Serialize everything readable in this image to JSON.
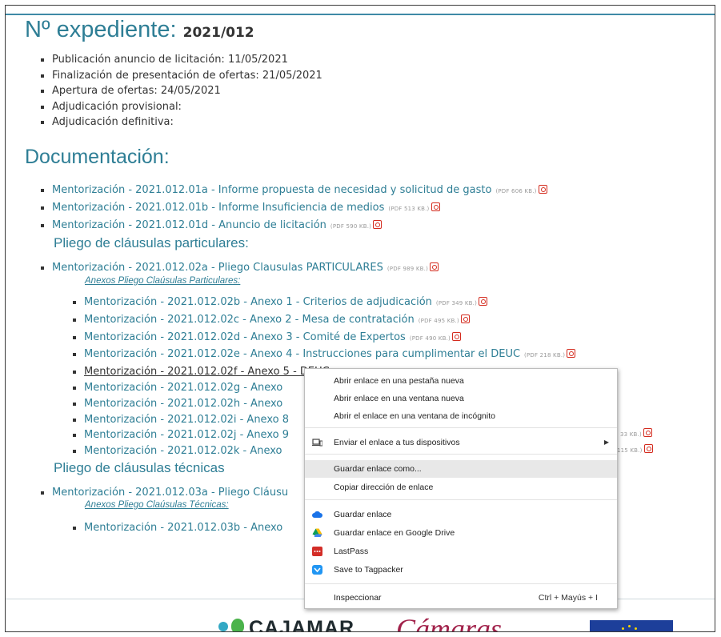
{
  "header": {
    "label": "Nº expediente:",
    "number": "2021/012"
  },
  "dates": [
    "Publicación anuncio de licitación: 11/05/2021",
    "Finalización de presentación de ofertas: 21/05/2021",
    "Apertura de ofertas: 24/05/2021",
    "Adjudicación provisional:",
    "Adjudicación definitiva:"
  ],
  "documentation": {
    "title": "Documentación:",
    "docs": [
      {
        "text": "Mentorización - 2021.012.01a - Informe propuesta de necesidad y solicitud de gasto",
        "size": "(PDF 606 KB.)"
      },
      {
        "text": "Mentorización - 2021.012.01b - Informe Insuficiencia de medios",
        "size": "(PDF 513 KB.)"
      },
      {
        "text": "Mentorización - 2021.012.01d - Anuncio de licitación",
        "size": "(PDF 590 KB.)"
      }
    ],
    "particulares": {
      "title": "Pliego de cláusulas particulares:",
      "main": {
        "text": "Mentorización - 2021.012.02a - Pliego Clausulas PARTICULARES",
        "size": "(PDF 989 KB.)"
      },
      "annex_label": "Anexos Pliego Claúsulas Particulares:",
      "annexes": [
        {
          "text": "Mentorización - 2021.012.02b - Anexo 1 - Criterios de adjudicación",
          "size": "(PDF 349 KB.)"
        },
        {
          "text": "Mentorización - 2021.012.02c - Anexo 2 - Mesa de contratación",
          "size": "(PDF 495 KB.)"
        },
        {
          "text": "Mentorización - 2021.012.02d - Anexo 3 - Comité de Expertos",
          "size": "(PDF 490 KB.)"
        },
        {
          "text": "Mentorización - 2021.012.02e - Anexo 4 - Instrucciones para cumplimentar el DEUC",
          "size": "(PDF 218 KB.)"
        },
        {
          "text": "Mentorización - 2021.012.02f - Anexo 5 - DEUC",
          "size": ""
        },
        {
          "text": "Mentorización - 2021.012.02g - Anexo",
          "size": ""
        },
        {
          "text": "Mentorización - 2021.012.02h - Anexo",
          "size": ""
        },
        {
          "text": "Mentorización - 2021.012.02i - Anexo 8",
          "size": ""
        },
        {
          "text": "Mentorización - 2021.012.02j - Anexo 9",
          "size": "33 KB.)"
        },
        {
          "text": "Mentorización - 2021.012.02k - Anexo",
          "size": "115 KB.)"
        }
      ]
    },
    "tecnicas": {
      "title": "Pliego de cláusulas técnicas",
      "main": {
        "text": "Mentorización - 2021.012.03a - Pliego Cláusu"
      },
      "annex_label": "Anexos Pliego Claúsulas Técnicas:",
      "annexes": [
        {
          "text": "Mentorización - 2021.012.03b - Anexo"
        }
      ]
    }
  },
  "context_menu": {
    "items": [
      {
        "label": "Abrir enlace en una pestaña nueva"
      },
      {
        "label": "Abrir enlace en una ventana nueva"
      },
      {
        "label": "Abrir el enlace en una ventana de incógnito"
      },
      {
        "label": "Enviar el enlace a tus dispositivos",
        "icon": "devices-icon"
      },
      {
        "label": "Guardar enlace como...",
        "highlighted": true
      },
      {
        "label": "Copiar dirección de enlace"
      },
      {
        "label": "Guardar enlace",
        "icon": "cloud-icon"
      },
      {
        "label": "Guardar enlace en Google Drive",
        "icon": "google-drive-icon"
      },
      {
        "label": "LastPass",
        "icon": "lastpass-icon"
      },
      {
        "label": "Save to Tagpacker",
        "icon": "tagpacker-icon"
      },
      {
        "label": "Inspeccionar",
        "shortcut": "Ctrl + Mayús + I"
      }
    ]
  },
  "footer": {
    "cajamar": "CAJAMAR",
    "camaras": "Cámaras"
  },
  "colors": {
    "accent": "#2e7e95",
    "pdf_red": "#d42b1e",
    "menu_highlight": "#e8e8e8"
  }
}
